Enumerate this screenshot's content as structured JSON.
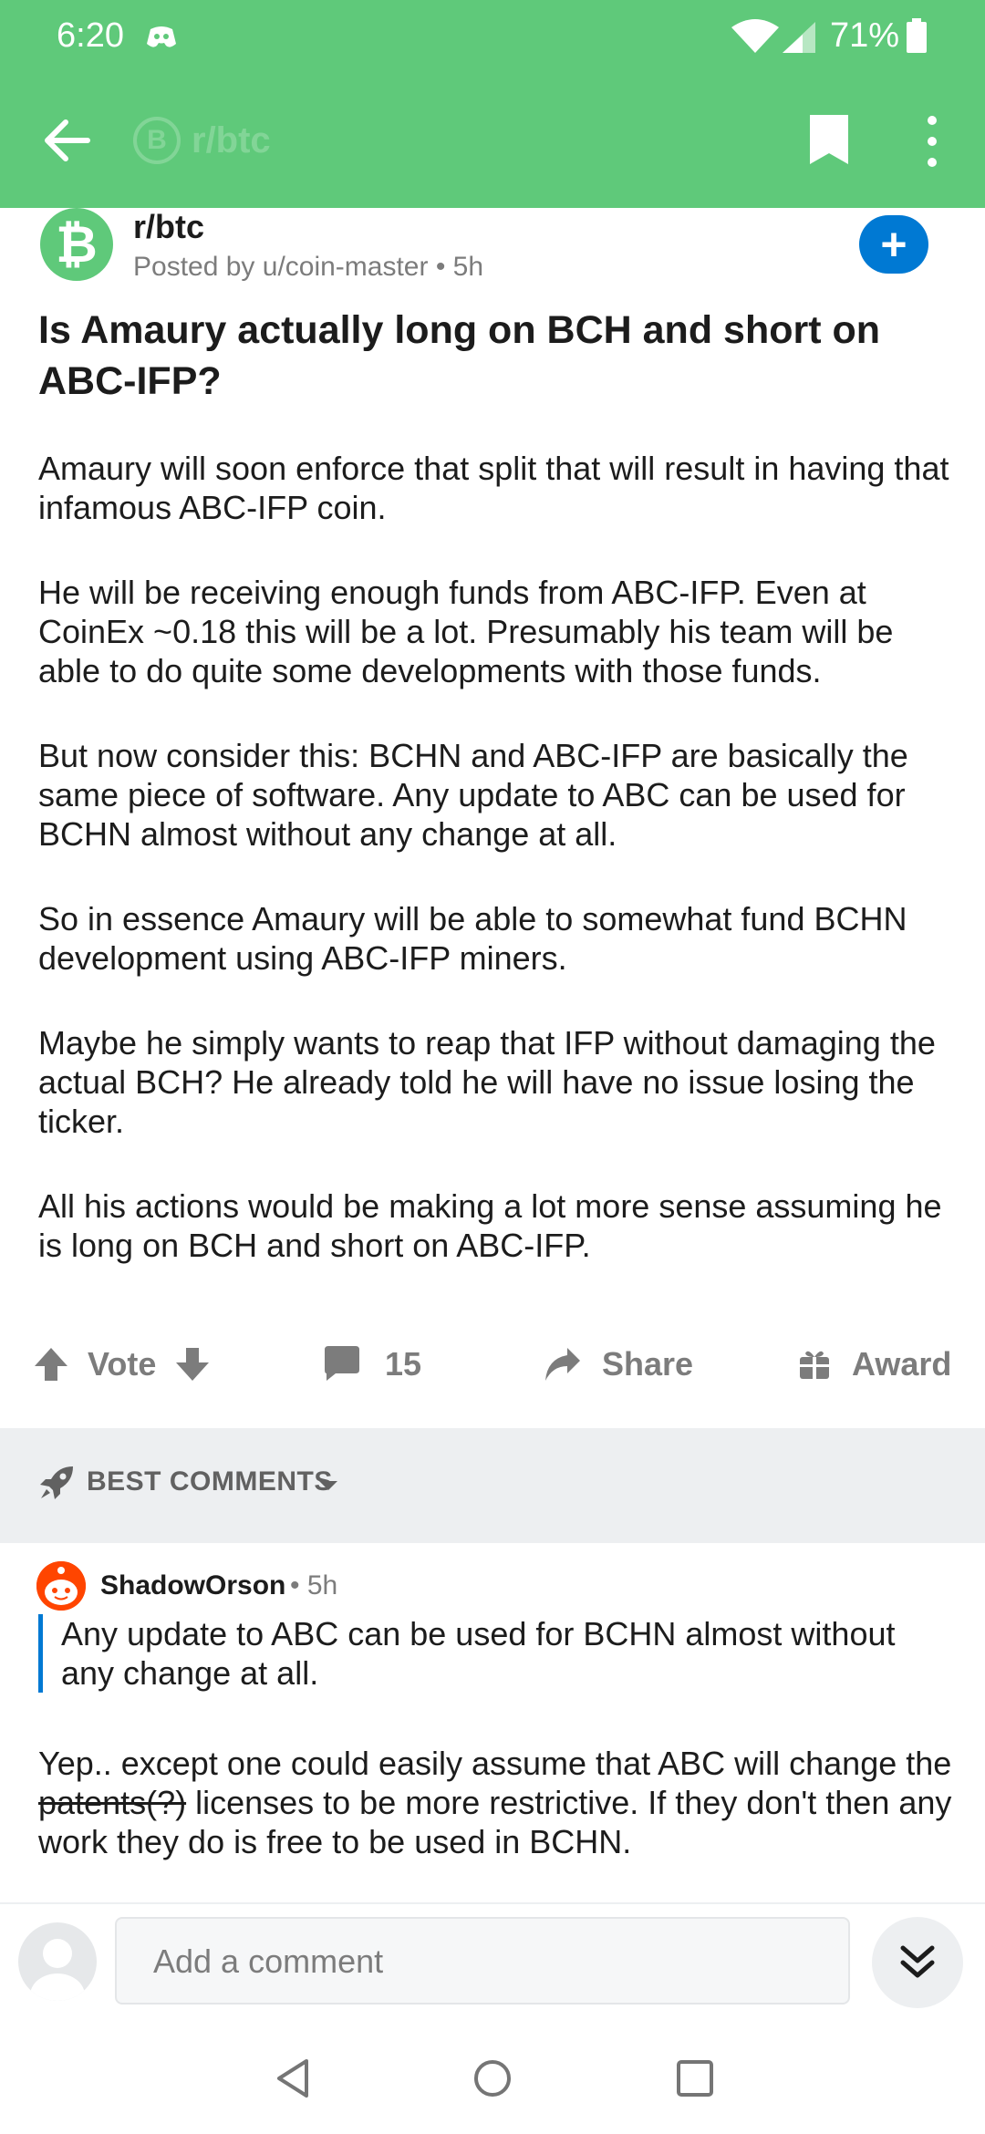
{
  "status": {
    "time": "6:20",
    "battery": "71%"
  },
  "appbar": {
    "subreddit_ghost": "r/btc",
    "coin_glyph": "B"
  },
  "post": {
    "subreddit": "r/btc",
    "posted_by": "Posted by u/coin-master • 5h",
    "join_symbol": "+",
    "title": "Is Amaury actually long on BCH and short on ABC-IFP?",
    "paragraphs": [
      "Amaury will soon enforce that split that will result in having that infamous ABC-IFP coin.",
      "He will be receiving enough funds from ABC-IFP. Even at CoinEx ~0.18 this will be a lot. Presumably his team will be able to do quite some developments with those funds.",
      "But now consider this: BCHN and ABC-IFP are basically the same piece of software. Any update to ABC can be used for BCHN almost without any change at all.",
      "So in essence Amaury will be able to somewhat fund BCHN development using ABC-IFP miners.",
      "Maybe he simply wants to reap that IFP without damaging the actual BCH? He already told he will have no issue losing the ticker.",
      "All his actions would be making a lot more sense assuming he is long on BCH and short on ABC-IFP."
    ]
  },
  "actions": {
    "vote": "Vote",
    "comments": "15",
    "share": "Share",
    "award": "Award"
  },
  "sort": {
    "label": "BEST COMMENTS"
  },
  "comment": {
    "user": "ShadowOrson",
    "time": "• 5h",
    "quote": "Any update to ABC can be used for BCHN almost without any change at all.",
    "text_before": "Yep.. except one could easily assume that ABC will change the ",
    "text_struck": "patents(?)",
    "text_after": " licenses to be more restrictive. If they don't then any work they do is free to be used in BCHN."
  },
  "composer": {
    "placeholder": "Add a comment"
  },
  "colors": {
    "header": "#5fc97a",
    "accent": "#0079d3",
    "band": "#edeff1"
  }
}
